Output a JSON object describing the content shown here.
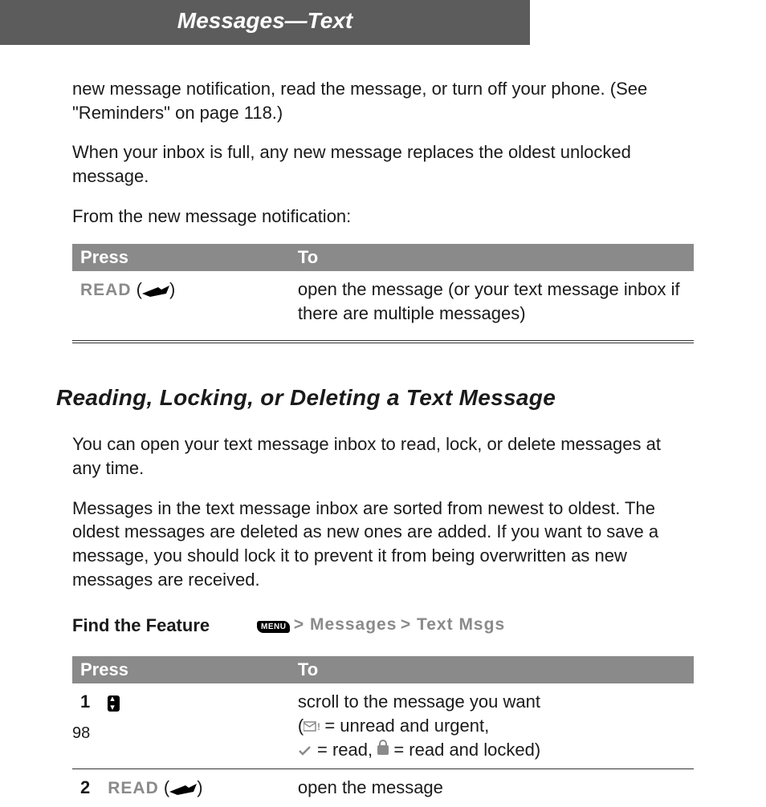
{
  "header": {
    "title": "Messages—Text"
  },
  "intro": {
    "p1": "new message notification, read the message, or turn off your phone. (See \"Reminders\" on page 118.)",
    "p2": "When your inbox is full, any new message replaces the oldest unlocked message.",
    "p3": "From the new message notification:"
  },
  "table1": {
    "head_press": "Press",
    "head_to": "To",
    "row1_press": "READ",
    "row1_to": "open the message (or your text message inbox if there are multiple messages)"
  },
  "section": {
    "heading": "Reading, Locking, or Deleting a Text Message"
  },
  "body": {
    "p1": "You can open your text message inbox to read, lock, or delete messages at any time.",
    "p2": "Messages in the text message inbox are sorted from newest to oldest. The oldest messages are deleted as new ones are added. If you want to save a message, you should lock it to prevent it from being overwritten as new messages are received."
  },
  "find_feature": {
    "label": "Find the Feature",
    "menu_key": "MENU",
    "sep": " > ",
    "path1": "Messages",
    "path2": "Text Msgs"
  },
  "table2": {
    "head_press": "Press",
    "head_to": "To",
    "step1": "1",
    "step1_to_a": "scroll to the message you want",
    "step1_to_b_prefix": "(",
    "step1_to_b_1": " = unread and urgent,",
    "step1_to_b_2": " = read, ",
    "step1_to_b_3": " = read and locked)",
    "step2": "2",
    "step2_press": "READ",
    "step2_to": "open the message"
  },
  "page": "98"
}
